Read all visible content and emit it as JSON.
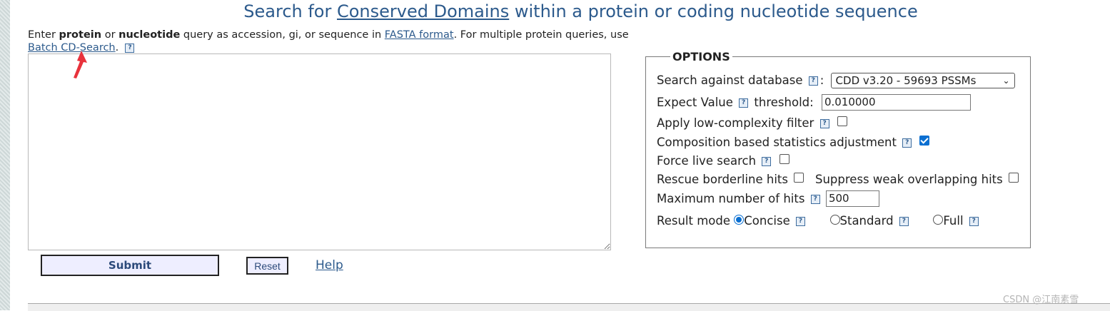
{
  "title": {
    "prefix": "Search for ",
    "link": "Conserved Domains",
    "suffix": " within a protein or coding nucleotide sequence"
  },
  "intro": {
    "t1": "Enter ",
    "b1": "protein",
    "t2": " or ",
    "b2": "nucleotide",
    "t3": " query as accession, gi, or sequence in ",
    "fasta_link": "FASTA format",
    "t4": ". For multiple protein queries, use ",
    "batch_link": "Batch CD-Search",
    "t5": "."
  },
  "query": {
    "value": ""
  },
  "buttons": {
    "submit": "Submit",
    "reset": "Reset",
    "help": "Help"
  },
  "options": {
    "legend": "OPTIONS",
    "database": {
      "label": "Search against database",
      "colon": ":",
      "value": "CDD v3.20 - 59693 PSSMs"
    },
    "expect": {
      "label1": "Expect Value",
      "label2": "threshold:",
      "value": "0.010000"
    },
    "low_complexity": {
      "label": "Apply low-complexity filter",
      "checked": false
    },
    "composition": {
      "label": "Composition based statistics adjustment",
      "checked": true
    },
    "force_live": {
      "label": "Force live search",
      "checked": false
    },
    "rescue": {
      "label": "Rescue borderline hits",
      "checked": false
    },
    "suppress": {
      "label": "Suppress weak overlapping hits",
      "checked": false
    },
    "max_hits": {
      "label": "Maximum number of hits",
      "value": "500"
    },
    "result_mode": {
      "label": "Result mode",
      "options": [
        "Concise",
        "Standard",
        "Full"
      ],
      "selected": "Concise"
    }
  },
  "help_icon_glyph": "?",
  "watermark": "CSDN @江南素雪",
  "colors": {
    "link": "#2c5a8c",
    "checked": "#0a6fd1",
    "annotation_arrow": "#e8323c"
  }
}
